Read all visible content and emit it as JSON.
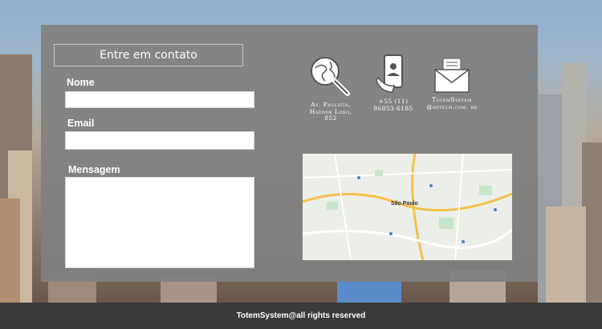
{
  "form": {
    "title": "Entre em contato",
    "name_label": "Nome",
    "name_value": "",
    "email_label": "Email",
    "email_value": "",
    "message_label": "Mensagem",
    "message_value": ""
  },
  "contacts": [
    {
      "icon": "globe-search-icon",
      "text": "Av. Paulista, Haddok Lobo, 852"
    },
    {
      "icon": "phone-contact-icon",
      "text": "+55 (11) 96853-6185"
    },
    {
      "icon": "envelope-icon",
      "text": "TotemSystem @sptech.com. br"
    }
  ],
  "map": {
    "city_label": "São Paulo"
  },
  "footer": {
    "text": "TotemSystem@all rights reserved"
  },
  "colors": {
    "panel": "#808080",
    "footer": "#3a3a3a",
    "text": "#ffffff"
  }
}
